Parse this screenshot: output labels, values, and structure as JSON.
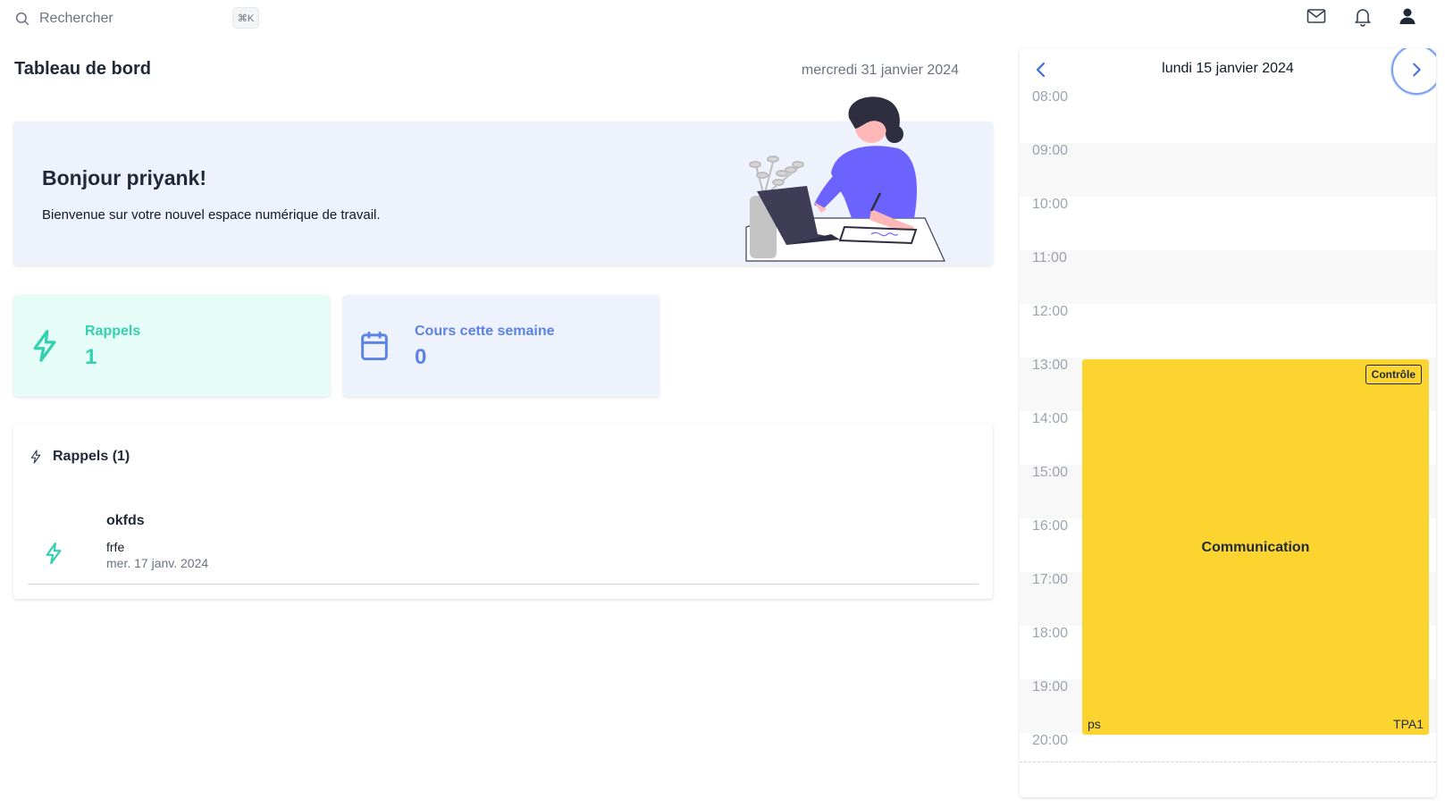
{
  "colors": {
    "accent_green": "#34d1b0",
    "accent_blue": "#5b83e6",
    "event_yellow": "#fcd42f",
    "illustration_purple": "#6c63ff"
  },
  "topbar": {
    "search_placeholder": "Rechercher",
    "shortcut": "⌘K",
    "icons": [
      "mail-icon",
      "bell-icon",
      "user-icon"
    ]
  },
  "header": {
    "title": "Tableau de bord",
    "date": "mercredi 31 janvier 2024"
  },
  "welcome": {
    "greeting": "Bonjour priyank!",
    "message": "Bienvenue sur votre nouvel espace numérique de travail."
  },
  "stats": {
    "reminders": {
      "label": "Rappels",
      "value": "1",
      "icon": "bolt-icon"
    },
    "courses": {
      "label": "Cours cette semaine",
      "value": "0",
      "icon": "calendar-icon"
    }
  },
  "reminders_list": {
    "title": "Rappels (1)",
    "items": [
      {
        "title": "okfds",
        "description": "frfe",
        "date": "mer. 17 janv. 2024"
      }
    ]
  },
  "calendar": {
    "date_title": "lundi 15 janvier 2024",
    "hours": [
      "08:00",
      "09:00",
      "10:00",
      "11:00",
      "12:00",
      "13:00",
      "14:00",
      "15:00",
      "16:00",
      "17:00",
      "18:00",
      "19:00",
      "20:00"
    ],
    "event": {
      "badge": "Contrôle",
      "name": "Communication",
      "left_label": "ps",
      "right_label": "TPA1",
      "start": "13:00",
      "end": "20:00"
    }
  }
}
